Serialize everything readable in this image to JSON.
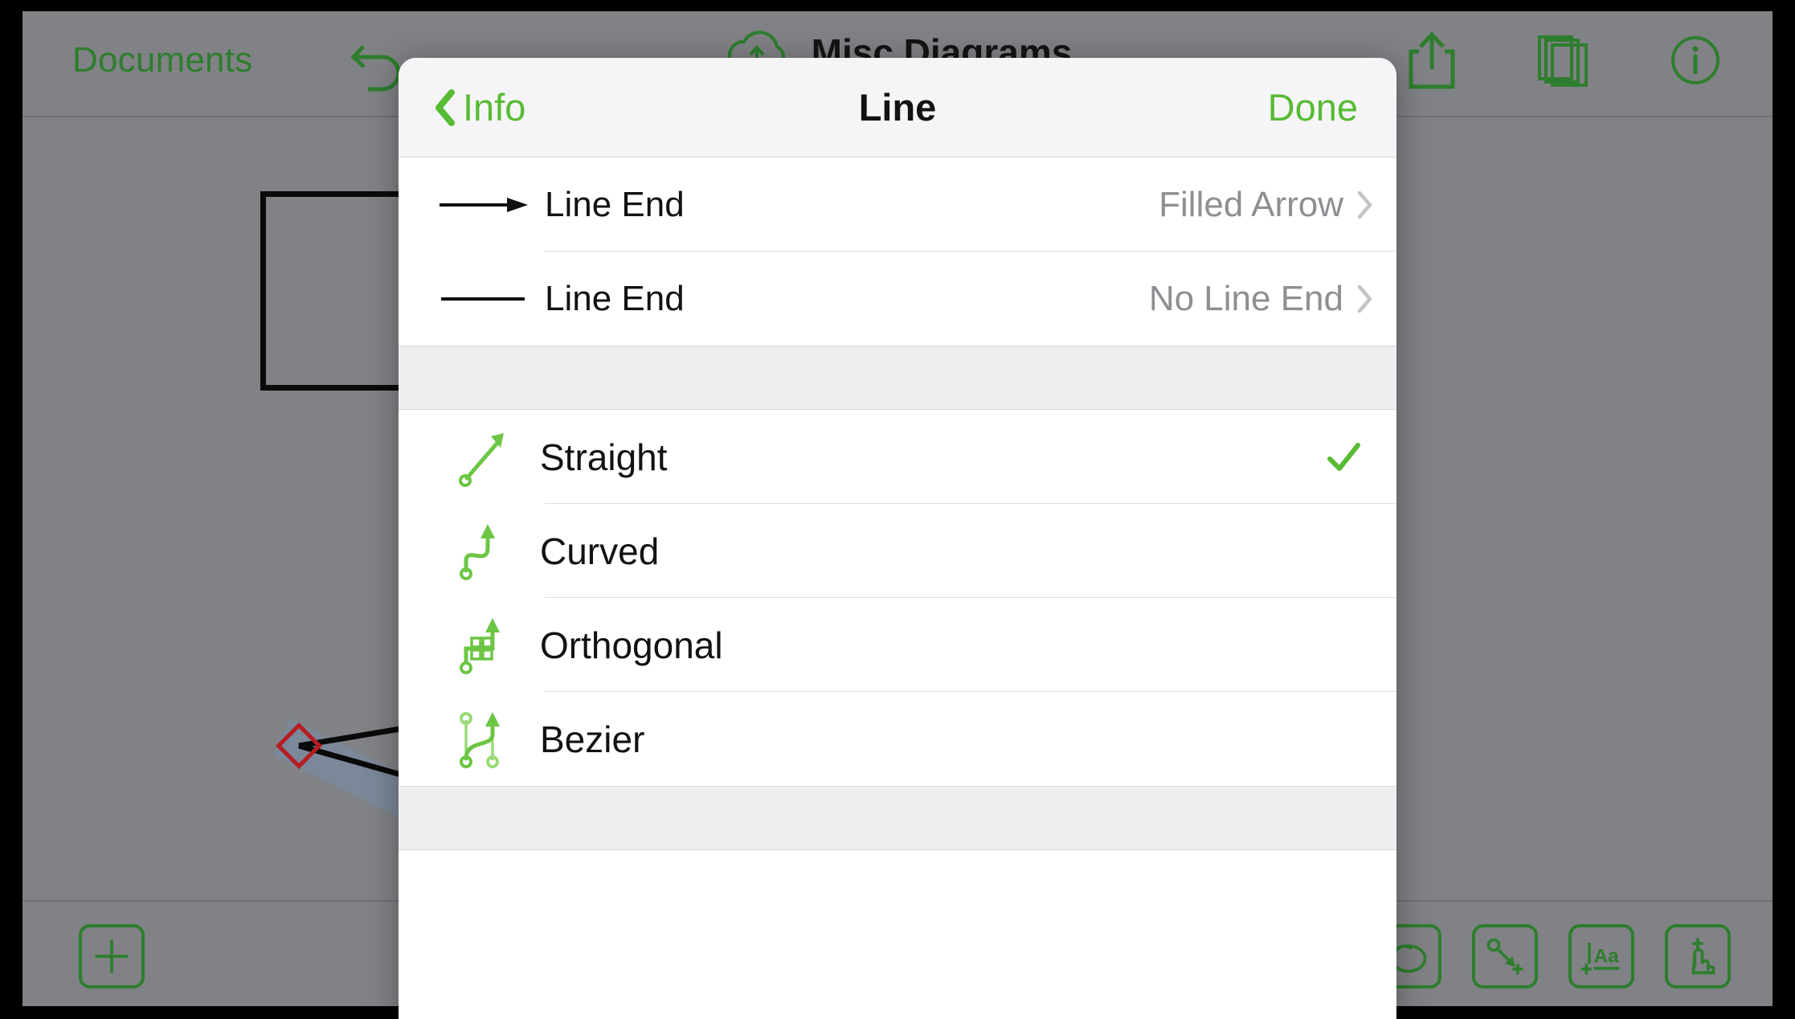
{
  "app": {
    "toolbar": {
      "documents_label": "Documents",
      "title": "Misc Diagrams",
      "undo_icon": "undo-icon",
      "cloud_icon": "cloud-upload-icon",
      "share_icon": "share-icon",
      "layers_icon": "layers-icon",
      "info_icon": "info-circle-icon"
    },
    "bottom_toolbar": {
      "add_icon": "plus-square-icon",
      "shape_icon": "shape-draw-icon",
      "line_icon": "line-add-icon",
      "text_icon": "text-add-icon",
      "touch_icon": "touch-add-icon"
    },
    "canvas": {
      "rectangle_shape": "rectangle",
      "diamond_handle": "diamond-handle",
      "connector_lines": "selected-connector"
    }
  },
  "popover": {
    "nav": {
      "back_label": "Info",
      "title": "Line",
      "done_label": "Done",
      "back_icon": "chevron-left-icon",
      "accent_color": "#57bb33"
    },
    "line_end_rows": [
      {
        "icon": "arrow-line-end-icon",
        "label": "Line End",
        "value": "Filled Arrow",
        "chevron": "chevron-right-icon"
      },
      {
        "icon": "plain-line-end-icon",
        "label": "Line End",
        "value": "No Line End",
        "chevron": "chevron-right-icon"
      }
    ],
    "line_types": [
      {
        "icon": "straight-line-icon",
        "label": "Straight",
        "selected": true
      },
      {
        "icon": "curved-line-icon",
        "label": "Curved",
        "selected": false
      },
      {
        "icon": "orthogonal-line-icon",
        "label": "Orthogonal",
        "selected": false
      },
      {
        "icon": "bezier-line-icon",
        "label": "Bezier",
        "selected": false
      }
    ],
    "check_icon": "checkmark-icon"
  }
}
